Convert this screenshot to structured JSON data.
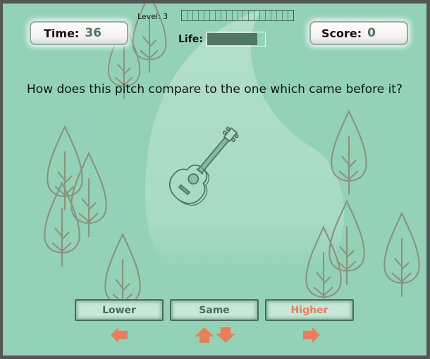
{
  "hud": {
    "time_label": "Time:",
    "time_value": "36",
    "score_label": "Score:",
    "score_value": "0",
    "level_label": "Level: 3",
    "level_progress": {
      "segments": 20,
      "filled": 0
    },
    "life_label": "Life:",
    "life_fraction": 0.88
  },
  "question": "How does this pitch compare to the one which came before it?",
  "center_icon": "guitar-icon",
  "answers": [
    {
      "label": "Lower",
      "key_icon": "left-arrow-icon"
    },
    {
      "label": "Same",
      "key_icon": "up-down-arrows-icon"
    },
    {
      "label": "Higher",
      "key_icon": "right-arrow-icon"
    }
  ],
  "colors": {
    "background": "#93d2b7",
    "frame": "#555555",
    "accent_orange": "#e97e59",
    "value_green": "#4e7563",
    "button_fill": "#c6e8d7",
    "tree_stroke": "#8c927c"
  }
}
